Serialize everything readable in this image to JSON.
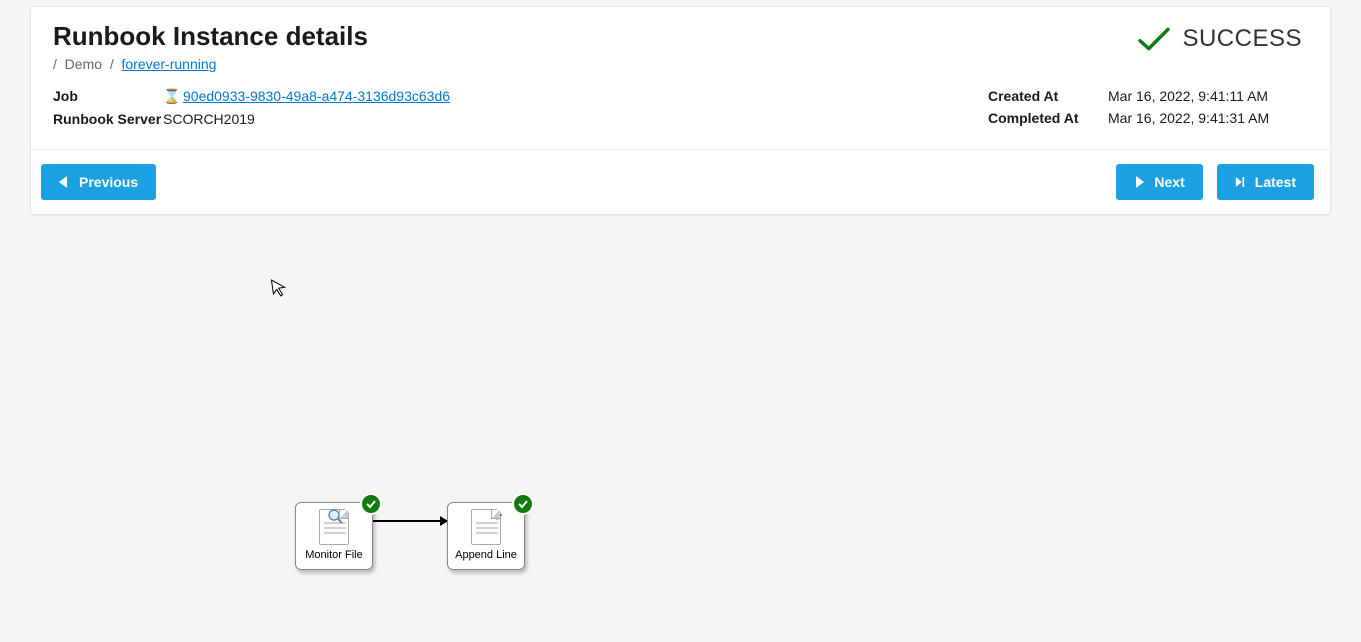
{
  "header": {
    "title": "Runbook Instance details",
    "status_text": "SUCCESS"
  },
  "breadcrumb": {
    "root_sep": "/",
    "segment1": "Demo",
    "sep": "/",
    "segment2": "forever-running"
  },
  "details": {
    "left": {
      "job_label": "Job",
      "job_id": "90ed0933-9830-49a8-a474-3136d93c63d6",
      "server_label": "Runbook Server",
      "server_value": "SCORCH2019"
    },
    "right": {
      "created_label": "Created At",
      "created_value": "Mar 16, 2022, 9:41:11 AM",
      "completed_label": "Completed At",
      "completed_value": "Mar 16, 2022, 9:41:31 AM"
    }
  },
  "buttons": {
    "previous": "Previous",
    "next": "Next",
    "latest": "Latest"
  },
  "diagram": {
    "node1": "Monitor File",
    "node2": "Append Line"
  }
}
